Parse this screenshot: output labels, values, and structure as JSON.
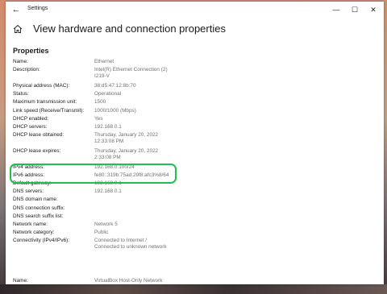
{
  "window": {
    "title": "Settings"
  },
  "controls": {
    "back": "←",
    "minimize": "—",
    "maximize": "☐",
    "close": "✕"
  },
  "header": {
    "title": "View hardware and connection properties"
  },
  "section": {
    "title": "Properties"
  },
  "properties": [
    {
      "key": "Name:",
      "value": [
        "Ethernet"
      ]
    },
    {
      "key": "Description:",
      "value": [
        "Intel(R) Ethernet Connection (2)",
        "I219-V"
      ]
    },
    {
      "key": "Physical address (MAC):",
      "value": [
        "38:d5:47:12:8b:70"
      ]
    },
    {
      "key": "Status:",
      "value": [
        "Operational"
      ]
    },
    {
      "key": "Maximum transmission unit:",
      "value": [
        "1500"
      ]
    },
    {
      "key": "Link speed (Receive/Transmit):",
      "value": [
        "1000/1000 (Mbps)"
      ]
    },
    {
      "key": "DHCP enabled:",
      "value": [
        "Yes"
      ]
    },
    {
      "key": "DHCP servers:",
      "value": [
        "192.168.0.1"
      ]
    },
    {
      "key": "DHCP lease obtained:",
      "value": [
        "Thursday, January 20, 2022",
        "12:33:08 PM"
      ]
    },
    {
      "key": "DHCP lease expires:",
      "value": [
        "Thursday, January 20, 2022",
        "2:33:08 PM"
      ]
    },
    {
      "key": "IPv4 address:",
      "value": [
        "192.168.0.100/24"
      ]
    },
    {
      "key": "IPv6 address:",
      "value": [
        "fe80::319b:75ad:29f8:afc3%8/64"
      ]
    },
    {
      "key": "Default gateway:",
      "value": [
        "192.168.0.1"
      ]
    },
    {
      "key": "DNS servers:",
      "value": [
        "192.168.0.1"
      ]
    },
    {
      "key": "DNS domain name:",
      "value": [
        ""
      ]
    },
    {
      "key": "DNS connection suffix:",
      "value": [
        ""
      ]
    },
    {
      "key": "DNS search suffix list:",
      "value": [
        ""
      ]
    },
    {
      "key": "Network name:",
      "value": [
        "Network 5"
      ]
    },
    {
      "key": "Network category:",
      "value": [
        "Public"
      ]
    },
    {
      "key": "Connectivity (IPv4/IPv6):",
      "value": [
        "Connected to Internet /",
        "Connected to unknown network"
      ]
    }
  ],
  "properties2": [
    {
      "key": "Name:",
      "value": [
        "VirtualBox Host-Only Network"
      ]
    }
  ],
  "colors": {
    "highlight": "#1fbf54"
  }
}
